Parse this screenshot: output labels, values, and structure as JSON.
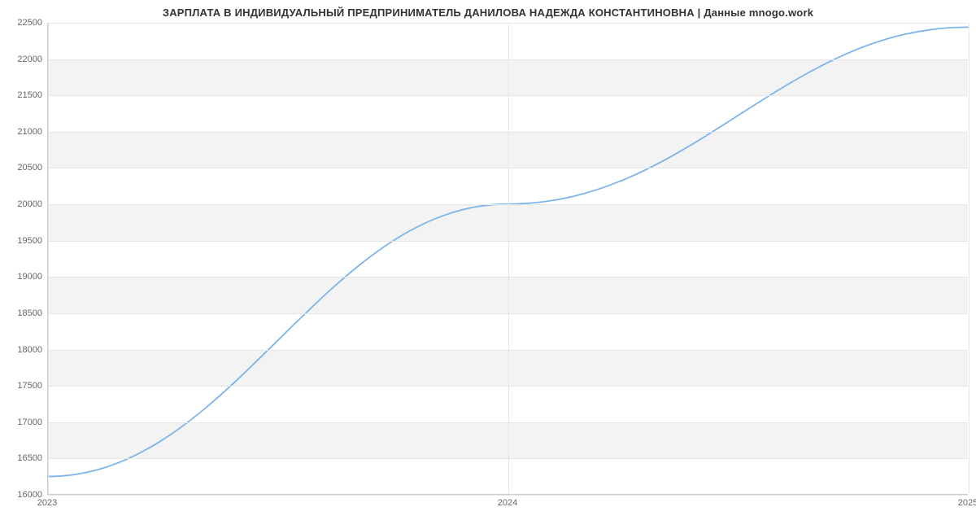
{
  "chart_data": {
    "type": "line",
    "title": "ЗАРПЛАТА В ИНДИВИДУАЛЬНЫЙ ПРЕДПРИНИМАТЕЛЬ ДАНИЛОВА НАДЕЖДА КОНСТАНТИНОВНА | Данные mnogo.work",
    "xlabel": "",
    "ylabel": "",
    "x": [
      2023,
      2024,
      2025
    ],
    "values": [
      16242,
      20000,
      22440
    ],
    "x_ticks": [
      2023,
      2024,
      2025
    ],
    "y_ticks": [
      16000,
      16500,
      17000,
      17500,
      18000,
      18500,
      19000,
      19500,
      20000,
      20500,
      21000,
      21500,
      22000,
      22500
    ],
    "xlim": [
      2023,
      2025
    ],
    "ylim": [
      16000,
      22500
    ],
    "grid": true,
    "series_color": "#7cb5ec"
  }
}
